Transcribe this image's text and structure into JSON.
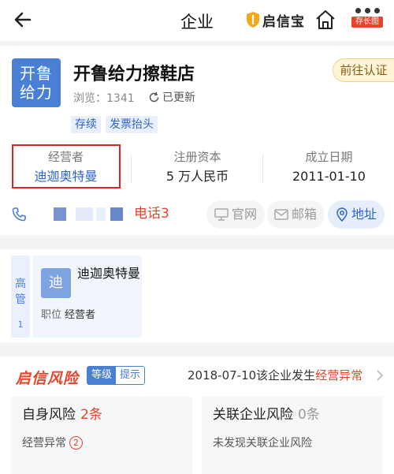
{
  "header": {
    "title": "企业",
    "brand": "启信宝",
    "more_tag": "存长图"
  },
  "company": {
    "logo_text": "开鲁给力",
    "name": "开鲁给力擦鞋店",
    "certify_label": "前往认证",
    "views_label": "浏览：1341",
    "updated_label": "已更新",
    "tags": [
      "存续",
      "发票抬头"
    ]
  },
  "stats": [
    {
      "label": "经营者",
      "value": "迪迦奥特曼"
    },
    {
      "label": "注册资本",
      "value": "5 万人民币"
    },
    {
      "label": "成立日期",
      "value": "2011-01-10"
    }
  ],
  "contact": {
    "phone_label": "电话3",
    "website": "官网",
    "email": "邮箱",
    "address": "地址"
  },
  "executives": {
    "section_label": "高管",
    "count": "1",
    "people": [
      {
        "avatar": "迪",
        "name": "迪迦奥特曼",
        "role_label": "职位",
        "role": "经营者"
      }
    ]
  },
  "risk": {
    "logo": "启信风险",
    "level_label": "等级",
    "hint_label": "提示",
    "event_prefix": "2018-07-10该企业发生",
    "event_highlight": "经营异常",
    "self": {
      "title": "自身风险",
      "count": "2条",
      "item": "经营异常",
      "item_count": "2"
    },
    "related": {
      "title": "关联企业风险",
      "count": "0条",
      "note": "未发现关联企业风险"
    }
  },
  "colors": {
    "accent": "#4a7fd6",
    "link": "#2d64c8",
    "danger": "#e8432b",
    "highlight_box": "#d9262b"
  }
}
